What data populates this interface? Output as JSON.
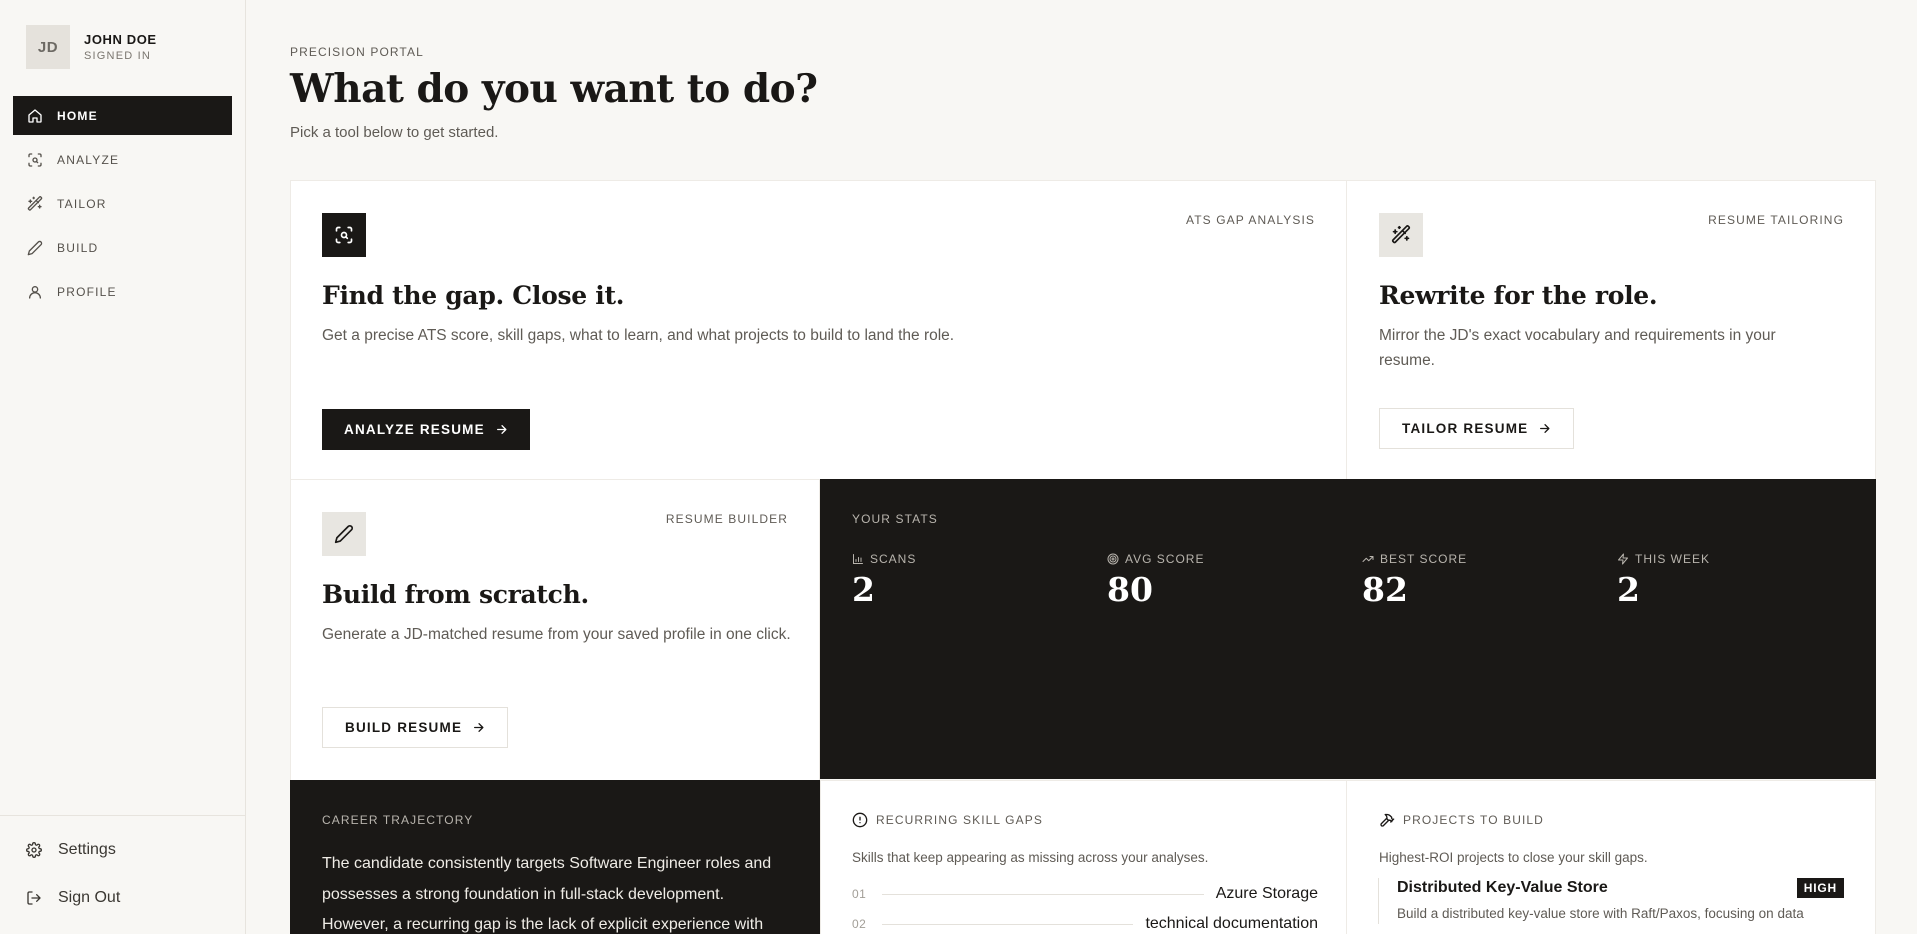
{
  "user": {
    "initials": "JD",
    "name": "JOHN DOE",
    "status": "SIGNED IN"
  },
  "nav": {
    "items": [
      {
        "label": "HOME",
        "icon": "home-icon",
        "active": true
      },
      {
        "label": "ANALYZE",
        "icon": "scan-search-icon"
      },
      {
        "label": "TAILOR",
        "icon": "magic-wand-icon"
      },
      {
        "label": "BUILD",
        "icon": "pen-icon"
      },
      {
        "label": "PROFILE",
        "icon": "user-icon"
      }
    ],
    "settings": "Settings",
    "signout": "Sign Out"
  },
  "header": {
    "eyebrow": "PRECISION PORTAL",
    "title": "What do you want to do?",
    "subtitle": "Pick a tool below to get started."
  },
  "analyze_card": {
    "tag": "ATS GAP ANALYSIS",
    "title": "Find the gap. Close it.",
    "desc": "Get a precise ATS score, skill gaps, what to learn, and what projects to build to land the role.",
    "button": "ANALYZE RESUME"
  },
  "tailor_card": {
    "tag": "RESUME TAILORING",
    "title": "Rewrite for the role.",
    "desc": "Mirror the JD's exact vocabulary and requirements in your resume.",
    "button": "TAILOR RESUME"
  },
  "build_card": {
    "tag": "RESUME BUILDER",
    "title": "Build from scratch.",
    "desc": "Generate a JD-matched resume from your saved profile in one click.",
    "button": "BUILD RESUME"
  },
  "stats": {
    "label": "YOUR STATS",
    "items": [
      {
        "label": "SCANS",
        "value": "2",
        "icon": "bar-chart-icon"
      },
      {
        "label": "AVG SCORE",
        "value": "80",
        "icon": "target-icon"
      },
      {
        "label": "BEST SCORE",
        "value": "82",
        "icon": "trending-up-icon"
      },
      {
        "label": "THIS WEEK",
        "value": "2",
        "icon": "zap-icon"
      }
    ]
  },
  "trajectory": {
    "label": "CAREER TRAJECTORY",
    "text": "The candidate consistently targets Software Engineer roles and possesses a strong foundation in full-stack development. However, a recurring gap is the lack of explicit experience with"
  },
  "skill_gaps": {
    "label": "RECURRING SKILL GAPS",
    "desc": "Skills that keep appearing as missing across your analyses.",
    "items": [
      {
        "num": "01",
        "name": "Azure Storage"
      },
      {
        "num": "02",
        "name": "technical documentation"
      }
    ]
  },
  "projects": {
    "label": "PROJECTS TO BUILD",
    "desc": "Highest-ROI projects to close your skill gaps.",
    "items": [
      {
        "name": "Distributed Key-Value Store",
        "priority": "HIGH",
        "desc": "Build a distributed key-value store with Raft/Paxos, focusing on data"
      }
    ]
  },
  "colors": {
    "ink": "#1a1816",
    "paper": "#f8f7f4",
    "card": "#ffffff",
    "muted": "#5f5b55"
  }
}
